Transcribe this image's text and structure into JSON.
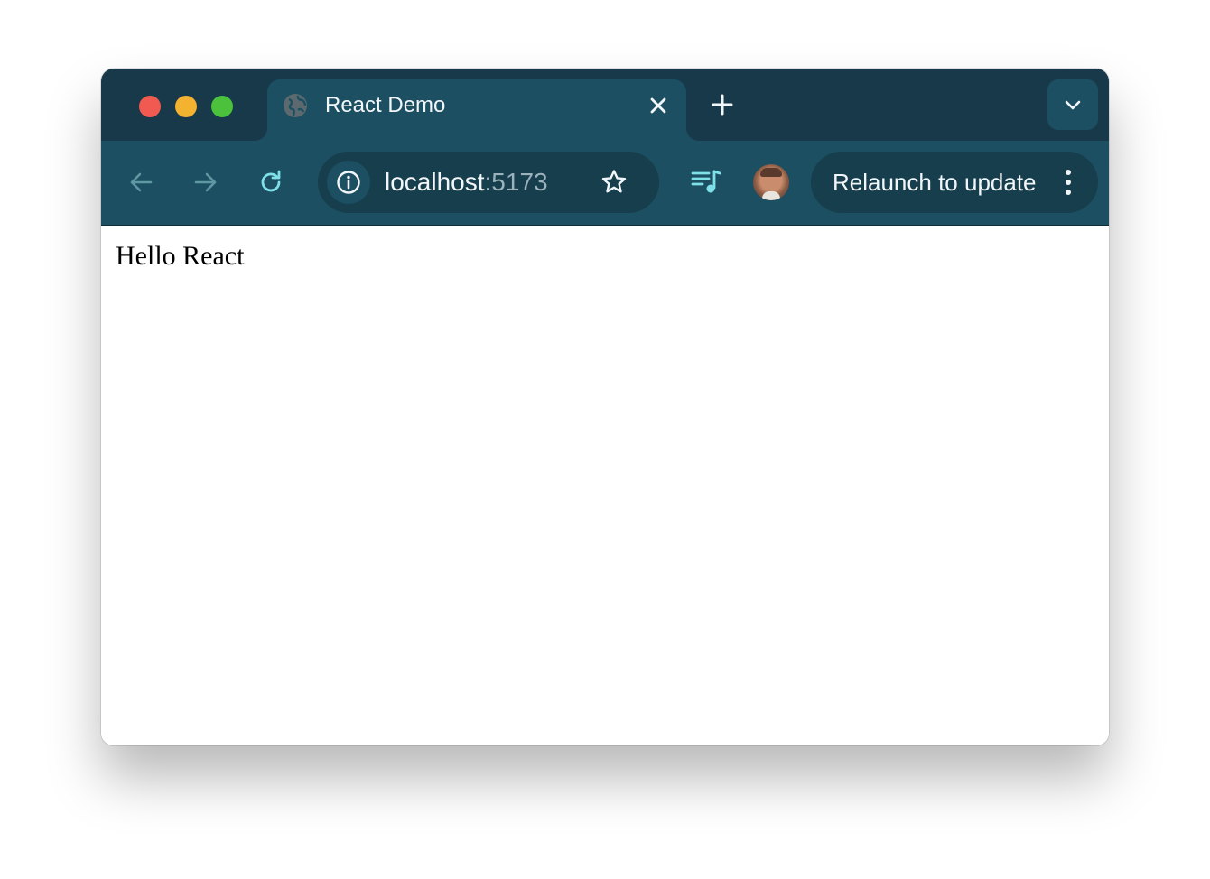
{
  "browser": {
    "tab": {
      "title": "React Demo",
      "favicon": "globe-icon"
    },
    "address_bar": {
      "host": "localhost",
      "port": ":5173"
    },
    "relaunch_label": "Relaunch to update",
    "icons": {
      "close": "close-icon",
      "new_tab": "plus-icon",
      "tab_search": "chevron-down-icon",
      "back": "arrow-left-icon",
      "forward": "arrow-right-icon",
      "reload": "reload-icon",
      "site_info": "info-icon",
      "bookmark": "star-icon",
      "media": "media-queue-icon",
      "menu": "kebab-menu-icon"
    },
    "colors": {
      "tabstrip": "#17394a",
      "toolbar": "#1c4f61",
      "accent": "#7fe0e8"
    }
  },
  "page": {
    "text": "Hello React"
  }
}
